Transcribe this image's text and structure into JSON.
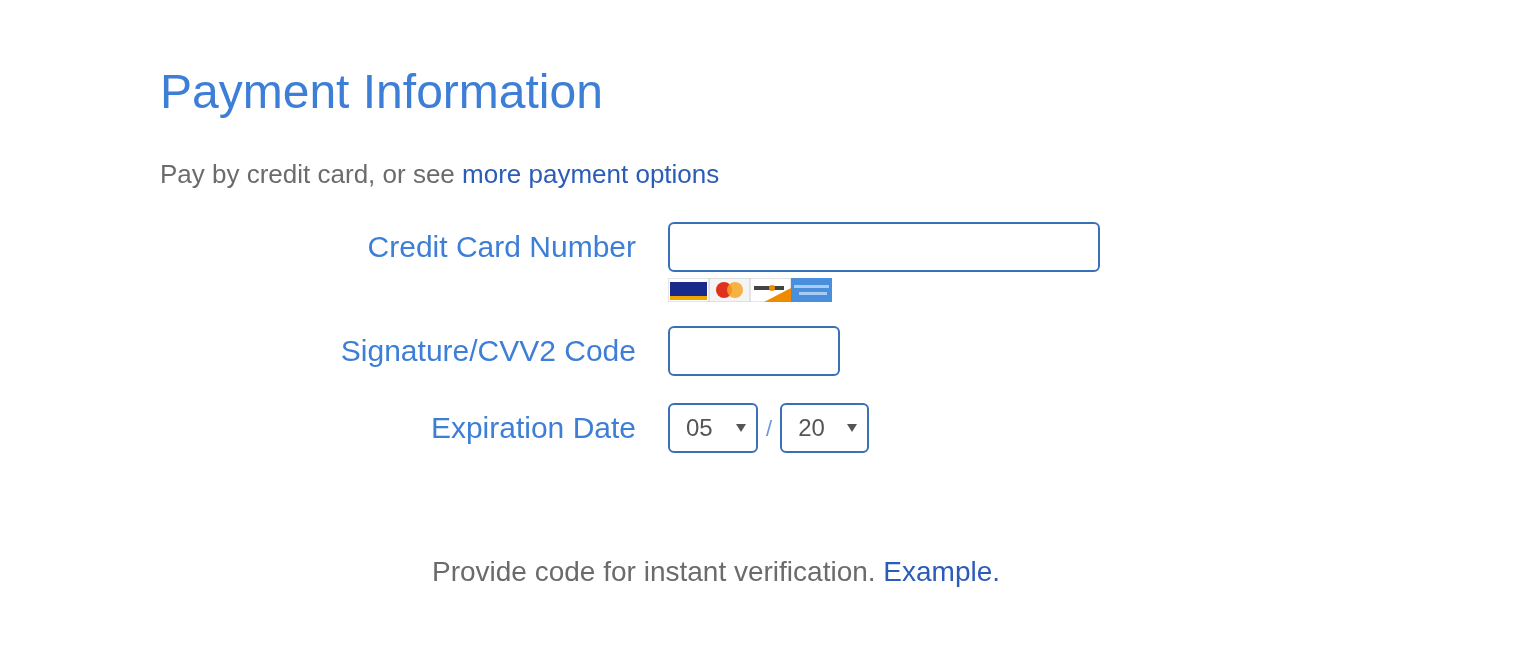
{
  "title": "Payment Information",
  "intro": {
    "text": "Pay by credit card, or see ",
    "link": "more payment options"
  },
  "card_number": {
    "label": "Credit Card Number"
  },
  "cvv": {
    "label": "Signature/CVV2 Code"
  },
  "expiration": {
    "label": "Expiration Date",
    "month": "05",
    "separator": "/",
    "year": "20"
  },
  "footer": {
    "text": "Provide code for instant verification. ",
    "link": "Example."
  }
}
